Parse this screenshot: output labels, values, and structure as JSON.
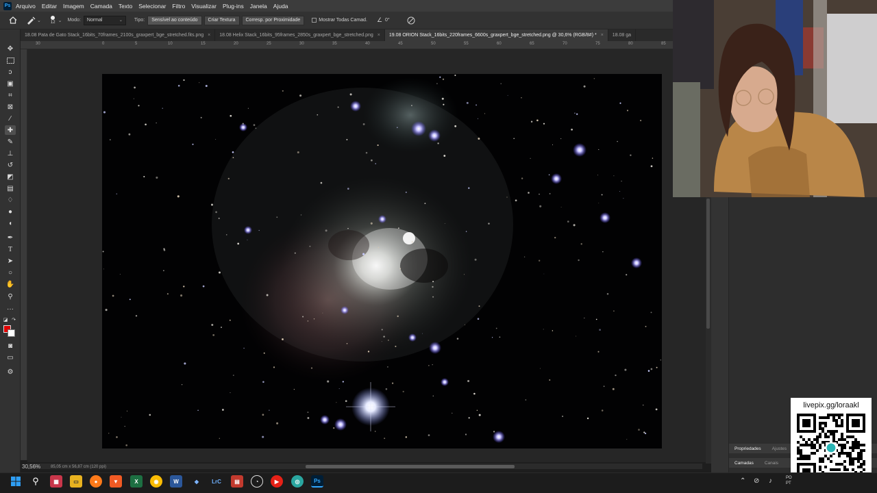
{
  "app": {
    "logo": "Ps"
  },
  "menu": [
    "Arquivo",
    "Editar",
    "Imagem",
    "Camada",
    "Texto",
    "Selecionar",
    "Filtro",
    "Visualizar",
    "Plug-ins",
    "Janela",
    "Ajuda"
  ],
  "options": {
    "brush_size": "12",
    "mode_label": "Modo:",
    "mode_value": "Normal",
    "type_label": "Tipo:",
    "type_buttons": [
      "Sensível ao conteúdo",
      "Criar Textura",
      "Corresp. por Proximidade"
    ],
    "sample_all_label": "Mostrar Todas Camad.",
    "angle_value": "0°"
  },
  "tabs": [
    {
      "label": "18.08 Pata de Gato Stack_16bits_70frames_2100s_graxpert_bge_stretched.fits.png",
      "close": "×",
      "active": false
    },
    {
      "label": "18.08 Helix Stack_16bits_95frames_2850s_graxpert_bge_stretched.png",
      "close": "×",
      "active": false
    },
    {
      "label": "19.08 ORION Stack_16bits_220frames_6600s_graxpert_bge_stretched.png @ 30,6% (RGB/8#) *",
      "close": "×",
      "active": true
    },
    {
      "label": "18.08 ga",
      "close": "",
      "active": false
    }
  ],
  "ruler": [
    "30",
    "0",
    "5",
    "10",
    "15",
    "20",
    "25",
    "30",
    "35",
    "40",
    "45",
    "50",
    "55",
    "60",
    "65",
    "70",
    "75",
    "80",
    "85"
  ],
  "status": {
    "zoom": "30,56%",
    "dimensions": "85,05 cm x 56,87 cm (120 ppi)"
  },
  "panels": {
    "top_tabs": [
      "Propriedades",
      "Ajustes"
    ],
    "bottom_tabs": [
      "Camadas",
      "Canais"
    ]
  },
  "overlay": {
    "qr_url": "livepix.gg/loraakl"
  },
  "taskbar": {
    "tray_lang": "PO\nPT"
  },
  "colors": {
    "foreground": "#e00000",
    "background": "#ffffff",
    "ps_accent": "#31a8ff"
  }
}
